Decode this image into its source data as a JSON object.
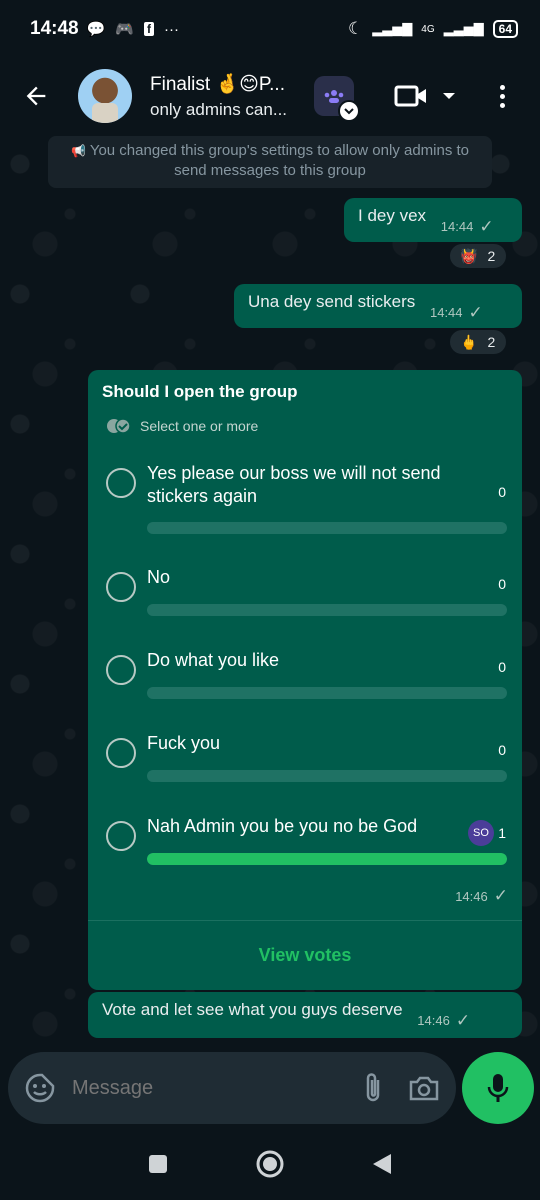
{
  "status_bar": {
    "time": "14:48",
    "network": "4G",
    "battery": "64"
  },
  "header": {
    "title": "Finalist 🤞😊P...",
    "subtitle": "only admins can..."
  },
  "system_message": "You changed this group's settings to allow only admins to send messages to this group",
  "messages": [
    {
      "text": "I dey vex",
      "time": "14:44",
      "reaction_emoji": "👹",
      "reaction_count": "2"
    },
    {
      "text": "Una dey send stickers",
      "time": "14:44",
      "reaction_emoji": "🖕",
      "reaction_count": "2"
    }
  ],
  "poll": {
    "question": "Should I open the group",
    "hint": "Select one or more",
    "options": [
      {
        "label": "Yes please our boss we will not send stickers again",
        "count": "0",
        "fraction": 0
      },
      {
        "label": "No",
        "count": "0",
        "fraction": 0
      },
      {
        "label": "Do what you like",
        "count": "0",
        "fraction": 0
      },
      {
        "label": "Fuck you",
        "count": "0",
        "fraction": 0
      },
      {
        "label": "Nah Admin you be you no be God",
        "count": "1",
        "fraction": 1,
        "voter": "SO"
      }
    ],
    "time": "14:46",
    "view_votes": "View votes"
  },
  "last_message": {
    "text": "Vote and let see what you guys deserve",
    "time": "14:46"
  },
  "composer": {
    "placeholder": "Message"
  },
  "colors": {
    "accent": "#21c063",
    "bubble_out": "#005c4b",
    "background": "#0b141a"
  }
}
